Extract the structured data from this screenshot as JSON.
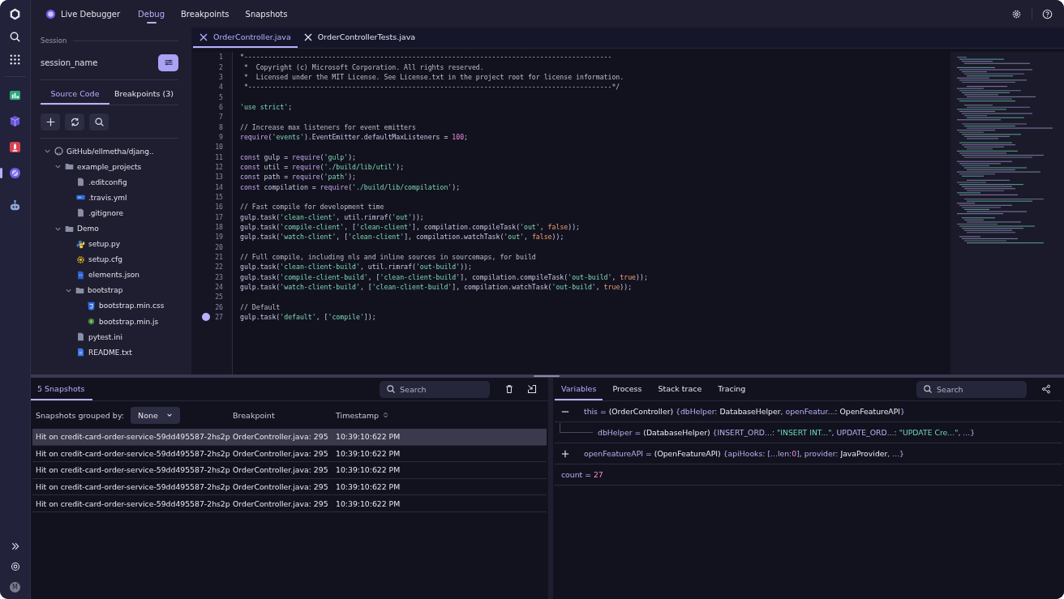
{
  "rail": {
    "top": [
      {
        "kind": "logo"
      },
      {
        "kind": "search"
      },
      {
        "kind": "apps"
      }
    ],
    "apps": [
      {
        "kind": "chart",
        "selected": false
      },
      {
        "kind": "cube",
        "selected": false
      },
      {
        "kind": "badge",
        "selected": false
      },
      {
        "kind": "debugger",
        "selected": true
      },
      {
        "kind": "robot",
        "selected": false
      }
    ],
    "bottom": {
      "avatar": "M"
    }
  },
  "topbar": {
    "app_title": "Live Debugger",
    "tabs": [
      {
        "label": "Debug",
        "selected": true
      },
      {
        "label": "Breakpoints",
        "selected": false
      },
      {
        "label": "Snapshots",
        "selected": false
      }
    ]
  },
  "sidebar": {
    "section_label": "Session",
    "session_name": "session_name",
    "tabs": [
      {
        "label": "Source Code",
        "selected": true
      },
      {
        "label": "Breakpoints (3)",
        "selected": false
      }
    ],
    "tree": [
      {
        "name": "GitHub/ellmetha/djang..",
        "kind": "repo",
        "expanded": true,
        "children": [
          {
            "name": "example_projects",
            "kind": "folder",
            "expanded": true,
            "children": [
              {
                "name": ".editconfig",
                "kind": "file"
              },
              {
                "name": ".travis.yml",
                "kind": "yaml"
              },
              {
                "name": ".gitignore",
                "kind": "file"
              }
            ]
          },
          {
            "name": "Demo",
            "kind": "folder",
            "expanded": true,
            "children": [
              {
                "name": "setup.py",
                "kind": "python"
              },
              {
                "name": "setup.cfg",
                "kind": "gear"
              },
              {
                "name": "elements.json",
                "kind": "json"
              },
              {
                "name": "bootstrap",
                "kind": "folder",
                "expanded": true,
                "children": [
                  {
                    "name": "bootstrap.min.css",
                    "kind": "css"
                  },
                  {
                    "name": "bootstrap.min.js",
                    "kind": "js"
                  }
                ]
              },
              {
                "name": "pytest.ini",
                "kind": "file"
              },
              {
                "name": "README.txt",
                "kind": "doc"
              }
            ]
          }
        ]
      }
    ]
  },
  "editor": {
    "tabs": [
      {
        "label": "OrderController.java",
        "selected": true
      },
      {
        "label": "OrderControllerTests.java",
        "selected": false
      }
    ],
    "lines": [
      {
        "number": "1",
        "breakpoint": false,
        "tokens": [
          {
            "kind": "comment",
            "text": "*--------------------------------------------------------------------------------------------"
          }
        ]
      },
      {
        "number": "2",
        "breakpoint": false,
        "tokens": [
          {
            "kind": "comment",
            "text": " *  Copyright (c) Microsoft Corporation. All rights reserved."
          }
        ]
      },
      {
        "number": "3",
        "breakpoint": false,
        "tokens": [
          {
            "kind": "comment",
            "text": " *  Licensed under the MIT License. See License.txt in the project root for license information."
          }
        ]
      },
      {
        "number": "4",
        "breakpoint": false,
        "tokens": [
          {
            "kind": "comment",
            "text": " *-------------------------------------------------------------------------------------------*/"
          }
        ]
      },
      {
        "number": "5",
        "breakpoint": false
      },
      {
        "number": "6",
        "breakpoint": false,
        "tokens": [
          {
            "kind": "string",
            "text": "'use strict'"
          },
          {
            "kind": "plain",
            "text": ";"
          }
        ]
      },
      {
        "number": "7",
        "breakpoint": false
      },
      {
        "number": "8",
        "breakpoint": false,
        "tokens": [
          {
            "kind": "comment",
            "text": "// Increase max listeners for event emitters"
          }
        ]
      },
      {
        "number": "9",
        "breakpoint": false,
        "tokens": [
          {
            "kind": "keyword",
            "text": "require"
          },
          {
            "kind": "plain",
            "text": "("
          },
          {
            "kind": "string",
            "text": "'events'"
          },
          {
            "kind": "plain",
            "text": ").EventEmitter.defaultMaxListeners = "
          },
          {
            "kind": "number",
            "text": "100"
          },
          {
            "kind": "plain",
            "text": ";"
          }
        ]
      },
      {
        "number": "10",
        "breakpoint": false
      },
      {
        "number": "11",
        "breakpoint": false,
        "tokens": [
          {
            "kind": "keyword",
            "text": "const"
          },
          {
            "kind": "plain",
            "text": " gulp = "
          },
          {
            "kind": "keyword",
            "text": "require"
          },
          {
            "kind": "plain",
            "text": "("
          },
          {
            "kind": "string",
            "text": "'gulp'"
          },
          {
            "kind": "plain",
            "text": ");"
          }
        ]
      },
      {
        "number": "12",
        "breakpoint": false,
        "tokens": [
          {
            "kind": "keyword",
            "text": "const"
          },
          {
            "kind": "plain",
            "text": " util = "
          },
          {
            "kind": "keyword",
            "text": "require"
          },
          {
            "kind": "plain",
            "text": "("
          },
          {
            "kind": "string",
            "text": "'./build/lib/util'"
          },
          {
            "kind": "plain",
            "text": ");"
          }
        ]
      },
      {
        "number": "13",
        "breakpoint": false,
        "tokens": [
          {
            "kind": "keyword",
            "text": "const"
          },
          {
            "kind": "plain",
            "text": " path = "
          },
          {
            "kind": "keyword",
            "text": "require"
          },
          {
            "kind": "plain",
            "text": "("
          },
          {
            "kind": "string",
            "text": "'path'"
          },
          {
            "kind": "plain",
            "text": ");"
          }
        ]
      },
      {
        "number": "14",
        "breakpoint": false,
        "tokens": [
          {
            "kind": "keyword",
            "text": "const"
          },
          {
            "kind": "plain",
            "text": " compilation = "
          },
          {
            "kind": "keyword",
            "text": "require"
          },
          {
            "kind": "plain",
            "text": "("
          },
          {
            "kind": "string",
            "text": "'./build/lib/compilation'"
          },
          {
            "kind": "plain",
            "text": ");"
          }
        ]
      },
      {
        "number": "15",
        "breakpoint": false
      },
      {
        "number": "16",
        "breakpoint": false,
        "tokens": [
          {
            "kind": "comment",
            "text": "// Fast compile for development time"
          }
        ]
      },
      {
        "number": "17",
        "breakpoint": false,
        "tokens": [
          {
            "kind": "plain",
            "text": "gulp.task("
          },
          {
            "kind": "string",
            "text": "'clean-client'"
          },
          {
            "kind": "plain",
            "text": ", util.rimraf("
          },
          {
            "kind": "string",
            "text": "'out'"
          },
          {
            "kind": "plain",
            "text": "));"
          }
        ]
      },
      {
        "number": "18",
        "breakpoint": false,
        "tokens": [
          {
            "kind": "plain",
            "text": "gulp.task("
          },
          {
            "kind": "string",
            "text": "'compile-client'"
          },
          {
            "kind": "plain",
            "text": ", ["
          },
          {
            "kind": "string",
            "text": "'clean-client'"
          },
          {
            "kind": "plain",
            "text": "], compilation.compileTask("
          },
          {
            "kind": "string",
            "text": "'out'"
          },
          {
            "kind": "plain",
            "text": ", "
          },
          {
            "kind": "bool",
            "text": "false"
          },
          {
            "kind": "plain",
            "text": "));"
          }
        ]
      },
      {
        "number": "19",
        "breakpoint": false,
        "tokens": [
          {
            "kind": "plain",
            "text": "gulp.task("
          },
          {
            "kind": "string",
            "text": "'watch-client'"
          },
          {
            "kind": "plain",
            "text": ", ["
          },
          {
            "kind": "string",
            "text": "'clean-client'"
          },
          {
            "kind": "plain",
            "text": "], compilation.watchTask("
          },
          {
            "kind": "string",
            "text": "'out'"
          },
          {
            "kind": "plain",
            "text": ", "
          },
          {
            "kind": "bool",
            "text": "false"
          },
          {
            "kind": "plain",
            "text": "));"
          }
        ]
      },
      {
        "number": "20",
        "breakpoint": false
      },
      {
        "number": "21",
        "breakpoint": false,
        "tokens": [
          {
            "kind": "comment",
            "text": "// Full compile, including nls and inline sources in sourcemaps, for build"
          }
        ]
      },
      {
        "number": "22",
        "breakpoint": false,
        "tokens": [
          {
            "kind": "plain",
            "text": "gulp.task("
          },
          {
            "kind": "string",
            "text": "'clean-client-build'"
          },
          {
            "kind": "plain",
            "text": ", util.rimraf("
          },
          {
            "kind": "string",
            "text": "'out-build'"
          },
          {
            "kind": "plain",
            "text": "));"
          }
        ]
      },
      {
        "number": "23",
        "breakpoint": false,
        "tokens": [
          {
            "kind": "plain",
            "text": "gulp.task("
          },
          {
            "kind": "string",
            "text": "'compile-client-build'"
          },
          {
            "kind": "plain",
            "text": ", ["
          },
          {
            "kind": "string",
            "text": "'clean-client-build'"
          },
          {
            "kind": "plain",
            "text": "], compilation.compileTask("
          },
          {
            "kind": "string",
            "text": "'out-build'"
          },
          {
            "kind": "plain",
            "text": ", "
          },
          {
            "kind": "bool",
            "text": "true"
          },
          {
            "kind": "plain",
            "text": "));"
          }
        ]
      },
      {
        "number": "24",
        "breakpoint": false,
        "tokens": [
          {
            "kind": "plain",
            "text": "gulp.task("
          },
          {
            "kind": "string",
            "text": "'watch-client-build'"
          },
          {
            "kind": "plain",
            "text": ", ["
          },
          {
            "kind": "string",
            "text": "'clean-client-build'"
          },
          {
            "kind": "plain",
            "text": "], compilation.watchTask("
          },
          {
            "kind": "string",
            "text": "'out-build'"
          },
          {
            "kind": "plain",
            "text": ", "
          },
          {
            "kind": "bool",
            "text": "true"
          },
          {
            "kind": "plain",
            "text": "));"
          }
        ]
      },
      {
        "number": "25",
        "breakpoint": false
      },
      {
        "number": "26",
        "breakpoint": false,
        "tokens": [
          {
            "kind": "comment",
            "text": "// Default"
          }
        ]
      },
      {
        "number": "27",
        "breakpoint": true,
        "tokens": [
          {
            "kind": "plain",
            "text": "gulp.task("
          },
          {
            "kind": "string",
            "text": "'default'"
          },
          {
            "kind": "plain",
            "text": ", ["
          },
          {
            "kind": "string",
            "text": "'compile'"
          },
          {
            "kind": "plain",
            "text": "]);"
          }
        ]
      }
    ]
  },
  "snapshots": {
    "tab": {
      "label": "5 Snapshots",
      "selected": true
    },
    "search": {
      "placeholder": "Search"
    },
    "group_label": "Snapshots grouped by:",
    "group_value": "None",
    "columns": [
      "Breakpoint",
      "Timestamp"
    ],
    "rows": [
      {
        "name": "Hit on credit-card-order-service-59dd495587-2hs2p",
        "breakpoint": "OrderController.java: 295",
        "timestamp": "10:39:10:622 PM",
        "selected": true
      },
      {
        "name": "Hit on credit-card-order-service-59dd495587-2hs2p",
        "breakpoint": "OrderController.java: 295",
        "timestamp": "10:39:10:622 PM",
        "selected": false
      },
      {
        "name": "Hit on credit-card-order-service-59dd495587-2hs2p",
        "breakpoint": "OrderController.java: 295",
        "timestamp": "10:39:10:622 PM",
        "selected": false
      },
      {
        "name": "Hit on credit-card-order-service-59dd495587-2hs2p",
        "breakpoint": "OrderController.java: 295",
        "timestamp": "10:39:10:622 PM",
        "selected": false
      },
      {
        "name": "Hit on credit-card-order-service-59dd495587-2hs2p",
        "breakpoint": "OrderController.java: 295",
        "timestamp": "10:39:10:622 PM",
        "selected": false
      }
    ]
  },
  "details": {
    "tabs": [
      {
        "label": "Variables",
        "selected": true
      },
      {
        "label": "Process",
        "selected": false
      },
      {
        "label": "Stack trace",
        "selected": false
      },
      {
        "label": "Tracing",
        "selected": false
      }
    ],
    "search": {
      "placeholder": "Search"
    },
    "variables": [
      {
        "kind": "object",
        "expanded": true,
        "tokens": [
          {
            "kind": "name",
            "text": "this"
          },
          {
            "kind": "op",
            "text": " = "
          },
          {
            "kind": "type",
            "text": "(OrderController)"
          },
          {
            "kind": "op",
            "text": " {"
          },
          {
            "kind": "name",
            "text": "dbHelper"
          },
          {
            "kind": "op",
            "text": ": "
          },
          {
            "kind": "type",
            "text": "DatabaseHelper"
          },
          {
            "kind": "op",
            "text": ", "
          },
          {
            "kind": "name",
            "text": "openFeatur..."
          },
          {
            "kind": "op",
            "text": ": "
          },
          {
            "kind": "type",
            "text": "OpenFeatureAPI"
          },
          {
            "kind": "op",
            "text": "}"
          }
        ],
        "children": [
          {
            "tokens": [
              {
                "kind": "name",
                "text": "dbHelper"
              },
              {
                "kind": "op",
                "text": " = "
              },
              {
                "kind": "type",
                "text": "(DatabaseHelper)"
              },
              {
                "kind": "op",
                "text": " {"
              },
              {
                "kind": "name",
                "text": "INSERT_ORD..."
              },
              {
                "kind": "op",
                "text": ": "
              },
              {
                "kind": "string",
                "text": "\"INSERT INT...\""
              },
              {
                "kind": "op",
                "text": ", "
              },
              {
                "kind": "name",
                "text": "UPDATE_ORD..."
              },
              {
                "kind": "op",
                "text": ": "
              },
              {
                "kind": "string",
                "text": "\"UPDATE Cre...\""
              },
              {
                "kind": "op",
                "text": ", ...}"
              }
            ]
          }
        ]
      },
      {
        "kind": "object",
        "expanded": false,
        "tokens": [
          {
            "kind": "name",
            "text": "openFeatureAPI"
          },
          {
            "kind": "op",
            "text": " = "
          },
          {
            "kind": "type",
            "text": "(OpenFeatureAPI)"
          },
          {
            "kind": "op",
            "text": " {"
          },
          {
            "kind": "name",
            "text": "apiHooks"
          },
          {
            "kind": "op",
            "text": ": [...len:"
          },
          {
            "kind": "number",
            "text": "0"
          },
          {
            "kind": "op",
            "text": "], "
          },
          {
            "kind": "name",
            "text": "provider"
          },
          {
            "kind": "op",
            "text": ": "
          },
          {
            "kind": "type",
            "text": "JavaProvider"
          },
          {
            "kind": "op",
            "text": ", ...}"
          }
        ]
      },
      {
        "kind": "primitive",
        "tokens": [
          {
            "kind": "name",
            "text": "count"
          },
          {
            "kind": "op",
            "text": " = "
          },
          {
            "kind": "number",
            "text": "27"
          }
        ]
      }
    ]
  }
}
